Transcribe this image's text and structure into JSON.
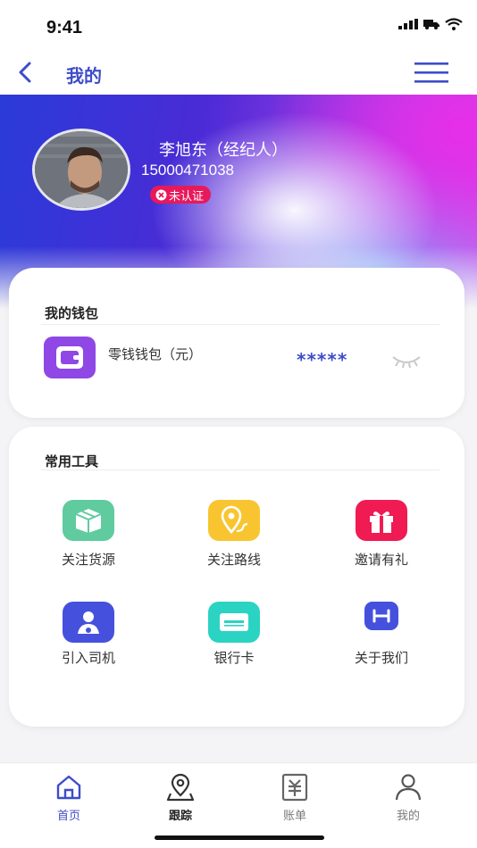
{
  "status_bar": {
    "time": "9:41"
  },
  "nav": {
    "title": "我的"
  },
  "profile": {
    "name": "李旭东（经纪人）",
    "phone": "15000471038",
    "badge": "未认证"
  },
  "wallet": {
    "title": "我的钱包",
    "item_label": "零钱钱包（元）",
    "amount": "*****"
  },
  "tools": {
    "title": "常用工具",
    "items": [
      {
        "label": "关注货源",
        "icon": "package-icon",
        "color": "#5fcb9e"
      },
      {
        "label": "关注路线",
        "icon": "route-pin-icon",
        "color": "#f8c531"
      },
      {
        "label": "邀请有礼",
        "icon": "gift-icon",
        "color": "#ef1b52"
      },
      {
        "label": "引入司机",
        "icon": "driver-icon",
        "color": "#4551dc"
      },
      {
        "label": "银行卡",
        "icon": "bank-card-icon",
        "color": "#2bd3c3"
      },
      {
        "label": "关于我们",
        "icon": "about-icon",
        "color": "#4551dc"
      }
    ]
  },
  "tab_bar": {
    "tabs": [
      {
        "label": "首页",
        "icon": "home-icon"
      },
      {
        "label": "跟踪",
        "icon": "location-icon"
      },
      {
        "label": "账单",
        "icon": "bill-icon"
      },
      {
        "label": "我的",
        "icon": "user-icon"
      }
    ]
  },
  "colors": {
    "brand": "#3e4cc9",
    "badge": "#e8195b",
    "wallet_icon": "#8f47e6"
  }
}
